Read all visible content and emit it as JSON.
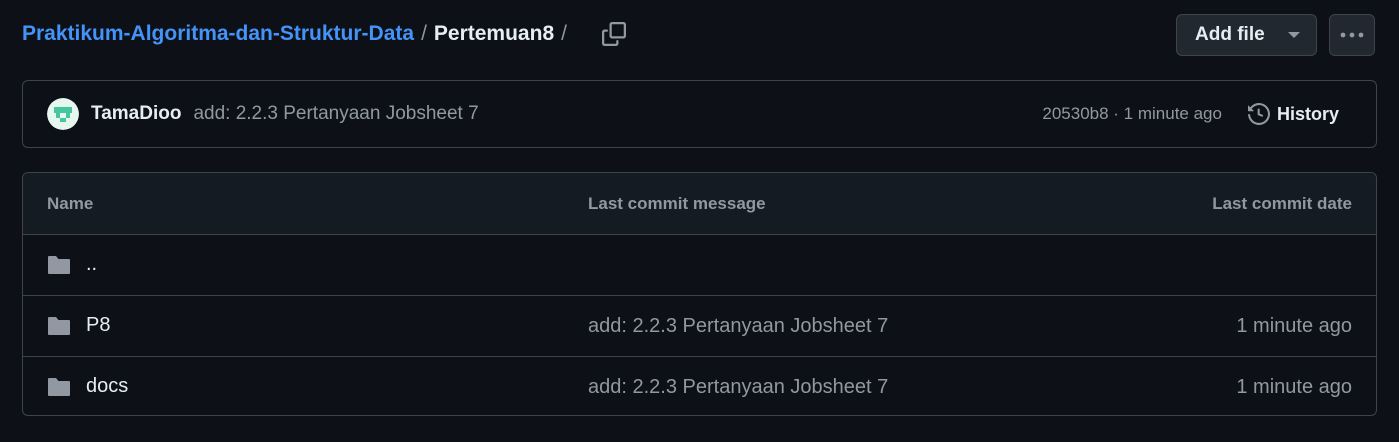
{
  "breadcrumb": {
    "repo": "Praktikum-Algoritma-dan-Struktur-Data",
    "separator": "/",
    "current": "Pertemuan8",
    "trailing_separator": "/"
  },
  "toolbar": {
    "add_file_label": "Add file",
    "more_icon": "kebab-horizontal-icon",
    "copy_icon": "copy-icon"
  },
  "latest_commit": {
    "author": "TamaDioo",
    "message": "add: 2.2.3 Pertanyaan Jobsheet 7",
    "meta": "20530b8 · 1 minute ago",
    "history_label": "History"
  },
  "file_table": {
    "headers": {
      "name": "Name",
      "message": "Last commit message",
      "date": "Last commit date"
    },
    "rows": [
      {
        "name": "..",
        "message": "",
        "date": ""
      },
      {
        "name": "P8",
        "message": "add: 2.2.3 Pertanyaan Jobsheet 7",
        "date": "1 minute ago"
      },
      {
        "name": "docs",
        "message": "add: 2.2.3 Pertanyaan Jobsheet 7",
        "date": "1 minute ago"
      }
    ]
  },
  "colors": {
    "background": "#0d1117",
    "link": "#4493f8",
    "border": "#3d444d",
    "muted": "#9198a1",
    "folder": "#9198a1"
  }
}
